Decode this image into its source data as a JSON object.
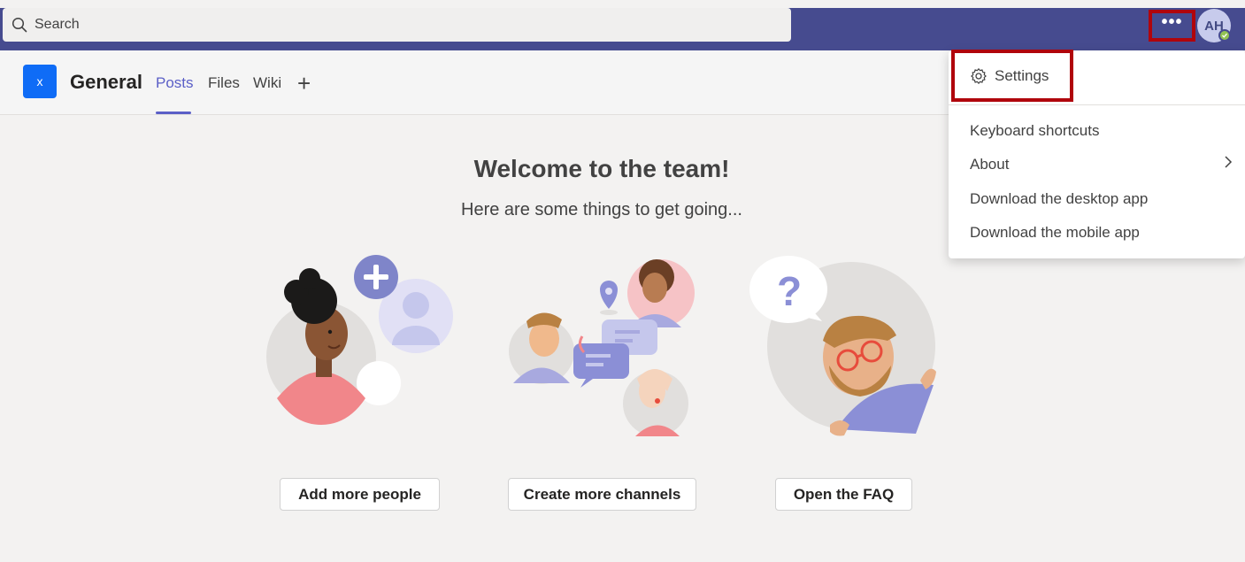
{
  "topbar": {
    "search_placeholder": "Search",
    "more_label": "•••",
    "avatar_initials": "AH"
  },
  "channel": {
    "team_initial": "X",
    "name": "General",
    "tabs": [
      {
        "label": "Posts",
        "active": true
      },
      {
        "label": "Files",
        "active": false
      },
      {
        "label": "Wiki",
        "active": false
      }
    ]
  },
  "welcome": {
    "title": "Welcome to the team!",
    "subtitle": "Here are some things to get going...",
    "actions": [
      {
        "label": "Add more people"
      },
      {
        "label": "Create more channels"
      },
      {
        "label": "Open the FAQ"
      }
    ]
  },
  "menu": {
    "settings_label": "Settings",
    "items": [
      {
        "label": "Keyboard shortcuts"
      },
      {
        "label": "About",
        "has_submenu": true
      },
      {
        "label": "Download the desktop app"
      },
      {
        "label": "Download the mobile app"
      }
    ]
  },
  "colors": {
    "topbar": "#464b8f",
    "accent": "#5b5fc7",
    "highlight": "#b0050c",
    "presence": "#92c353"
  }
}
